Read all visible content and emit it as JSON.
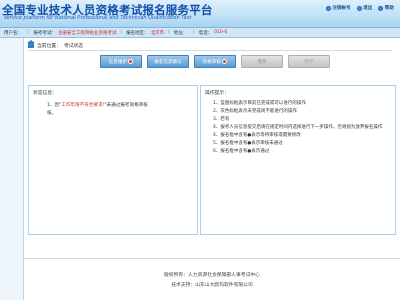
{
  "header": {
    "title": "全国专业技术人员资格考试报名服务平台",
    "subtitle": "service platform for National Professional and Technician Qualification Test",
    "links": [
      "注销帐号",
      "退出",
      "帮助"
    ]
  },
  "infobar": {
    "items": [
      {
        "label": "用户名：",
        "value": ""
      },
      {
        "label": "报考考试：",
        "value": "注册安全工程师执业资格考试"
      },
      {
        "label": "报名地区：",
        "value": "北京市"
      },
      {
        "label": "地址：",
        "value": ""
      },
      {
        "label": "电话：",
        "value": "010-6"
      }
    ]
  },
  "breadcrumb": {
    "label": "当前位置：",
    "page": "考试状态"
  },
  "steps": [
    {
      "label": "信息维护",
      "badge": true
    },
    {
      "label": "报名信息确认",
      "badge": false
    },
    {
      "label": "资格审核",
      "badge": true
    },
    {
      "label": "缴费",
      "badge": false
    },
    {
      "label": "打印",
      "badge": false
    }
  ],
  "status": {
    "title": "状态信息：",
    "line1_prefix": "1、因\"",
    "line1_link": "工作年限不符合要求!",
    "line1_suffix": "\"未通过报考资格审核",
    "line1_wrap": "核。"
  },
  "ops": {
    "title": "操作提示：",
    "items": [
      "1、蓝图标框表示目前已完成或可以进行的操作",
      "2、灰色标框表示未完成尚不能进行的操作",
      "3、若有",
      "4、报考人员信息提交后请在规定时间内选择进行下一步操作，否则视为放弃报名操作",
      "4、报名框中含有●表示等待审核或需要修改",
      "5、报名框中含有●表示审核未通过",
      "6、报名框中含有●表示通过"
    ]
  },
  "footer": {
    "line1": "版权所有：人力资源社会保障部人事考试中心",
    "line2": "技术支持：山东山大鸥玛软件有限公司"
  }
}
